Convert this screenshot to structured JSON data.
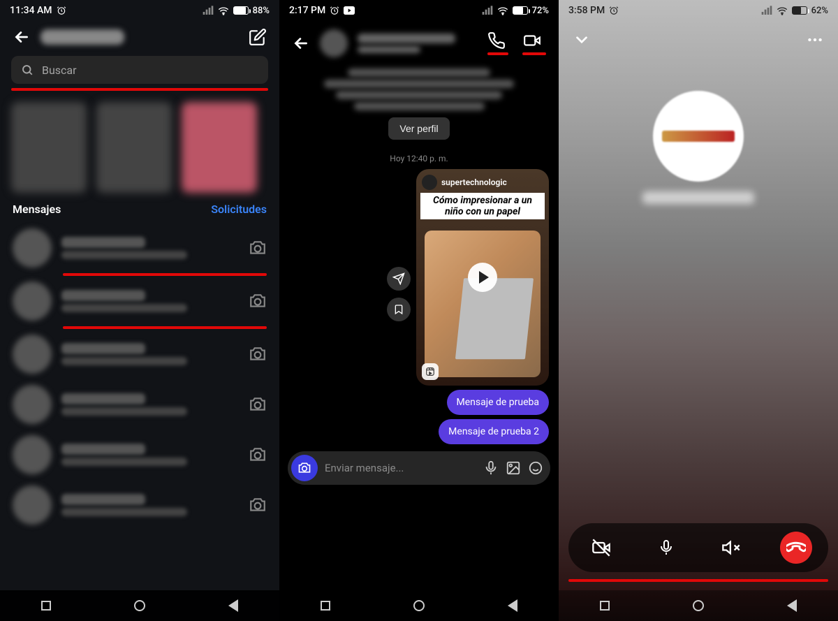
{
  "panel1": {
    "status": {
      "time": "11:34 AM",
      "battery": "88%",
      "battery_fill": 88
    },
    "search_placeholder": "Buscar",
    "tabs": {
      "messages": "Mensajes",
      "requests": "Solicitudes"
    }
  },
  "panel2": {
    "status": {
      "time": "2:17 PM",
      "battery": "72%",
      "battery_fill": 72
    },
    "view_profile": "Ver perfil",
    "timestamp": "Hoy 12:40 p. m.",
    "reel": {
      "author": "supertechnologic",
      "caption": "Cómo impresionar a un niño con un papel"
    },
    "messages": [
      "Mensaje de prueba",
      "Mensaje de prueba 2"
    ],
    "composer_placeholder": "Enviar mensaje..."
  },
  "panel3": {
    "status": {
      "time": "3:58 PM",
      "battery": "62%",
      "battery_fill": 62
    }
  }
}
